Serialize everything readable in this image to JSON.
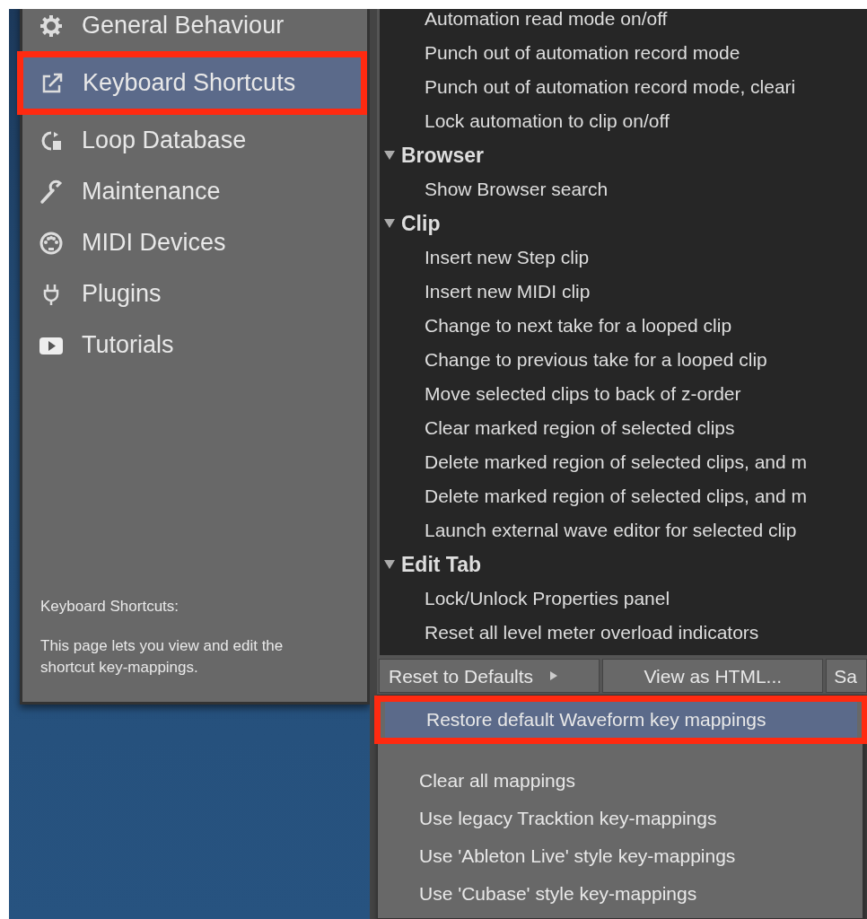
{
  "sidebar": {
    "items": [
      {
        "label": "General Behaviour",
        "selected": false,
        "highlighted": false
      },
      {
        "label": "Keyboard Shortcuts",
        "selected": true,
        "highlighted": true
      },
      {
        "label": "Loop Database",
        "selected": false,
        "highlighted": false
      },
      {
        "label": "Maintenance",
        "selected": false,
        "highlighted": false
      },
      {
        "label": "MIDI Devices",
        "selected": false,
        "highlighted": false
      },
      {
        "label": "Plugins",
        "selected": false,
        "highlighted": false
      },
      {
        "label": "Tutorials",
        "selected": false,
        "highlighted": false
      }
    ],
    "help_title": "Keyboard Shortcuts:",
    "help_text": "This page lets you view and edit the shortcut key-mappings."
  },
  "shortcuts": [
    {
      "kind": "item",
      "label": "Automation read mode on/off"
    },
    {
      "kind": "item",
      "label": "Punch out of automation record mode"
    },
    {
      "kind": "item",
      "label": "Punch out of automation record mode, cleari"
    },
    {
      "kind": "item",
      "label": "Lock automation to clip on/off"
    },
    {
      "kind": "group",
      "label": "Browser",
      "expanded": true,
      "children": [
        {
          "kind": "item",
          "label": "Show Browser search"
        }
      ]
    },
    {
      "kind": "group",
      "label": "Clip",
      "expanded": true,
      "children": [
        {
          "kind": "item",
          "label": "Insert new Step clip"
        },
        {
          "kind": "item",
          "label": "Insert new MIDI clip"
        },
        {
          "kind": "item",
          "label": "Change to next take for a looped clip"
        },
        {
          "kind": "item",
          "label": "Change to previous take for a looped clip"
        },
        {
          "kind": "item",
          "label": "Move selected clips to back of z-order"
        },
        {
          "kind": "item",
          "label": "Clear marked region of selected clips"
        },
        {
          "kind": "item",
          "label": "Delete marked region of selected clips, and m"
        },
        {
          "kind": "item",
          "label": "Delete marked region of selected clips, and m"
        },
        {
          "kind": "item",
          "label": "Launch external wave editor for selected clip"
        }
      ]
    },
    {
      "kind": "group",
      "label": "Edit Tab",
      "expanded": true,
      "children": [
        {
          "kind": "item",
          "label": "Lock/Unlock Properties panel"
        },
        {
          "kind": "item",
          "label": "Reset all level meter overload indicators"
        }
      ]
    }
  ],
  "buttons": [
    {
      "label": "Reset to Defaults",
      "has_submenu": true
    },
    {
      "label": "View as HTML...",
      "has_submenu": false
    },
    {
      "label": "Sa",
      "has_submenu": false
    }
  ],
  "menu": [
    {
      "label": "Restore default Waveform key mappings",
      "selected": true,
      "highlighted": true
    },
    {
      "label": "Clear all mappings",
      "selected": false,
      "highlighted": false
    },
    {
      "label": "Use legacy Tracktion key-mappings",
      "selected": false,
      "highlighted": false
    },
    {
      "label": "Use 'Ableton Live' style key-mappings",
      "selected": false,
      "highlighted": false
    },
    {
      "label": "Use 'Cubase' style key-mappings",
      "selected": false,
      "highlighted": false
    }
  ]
}
